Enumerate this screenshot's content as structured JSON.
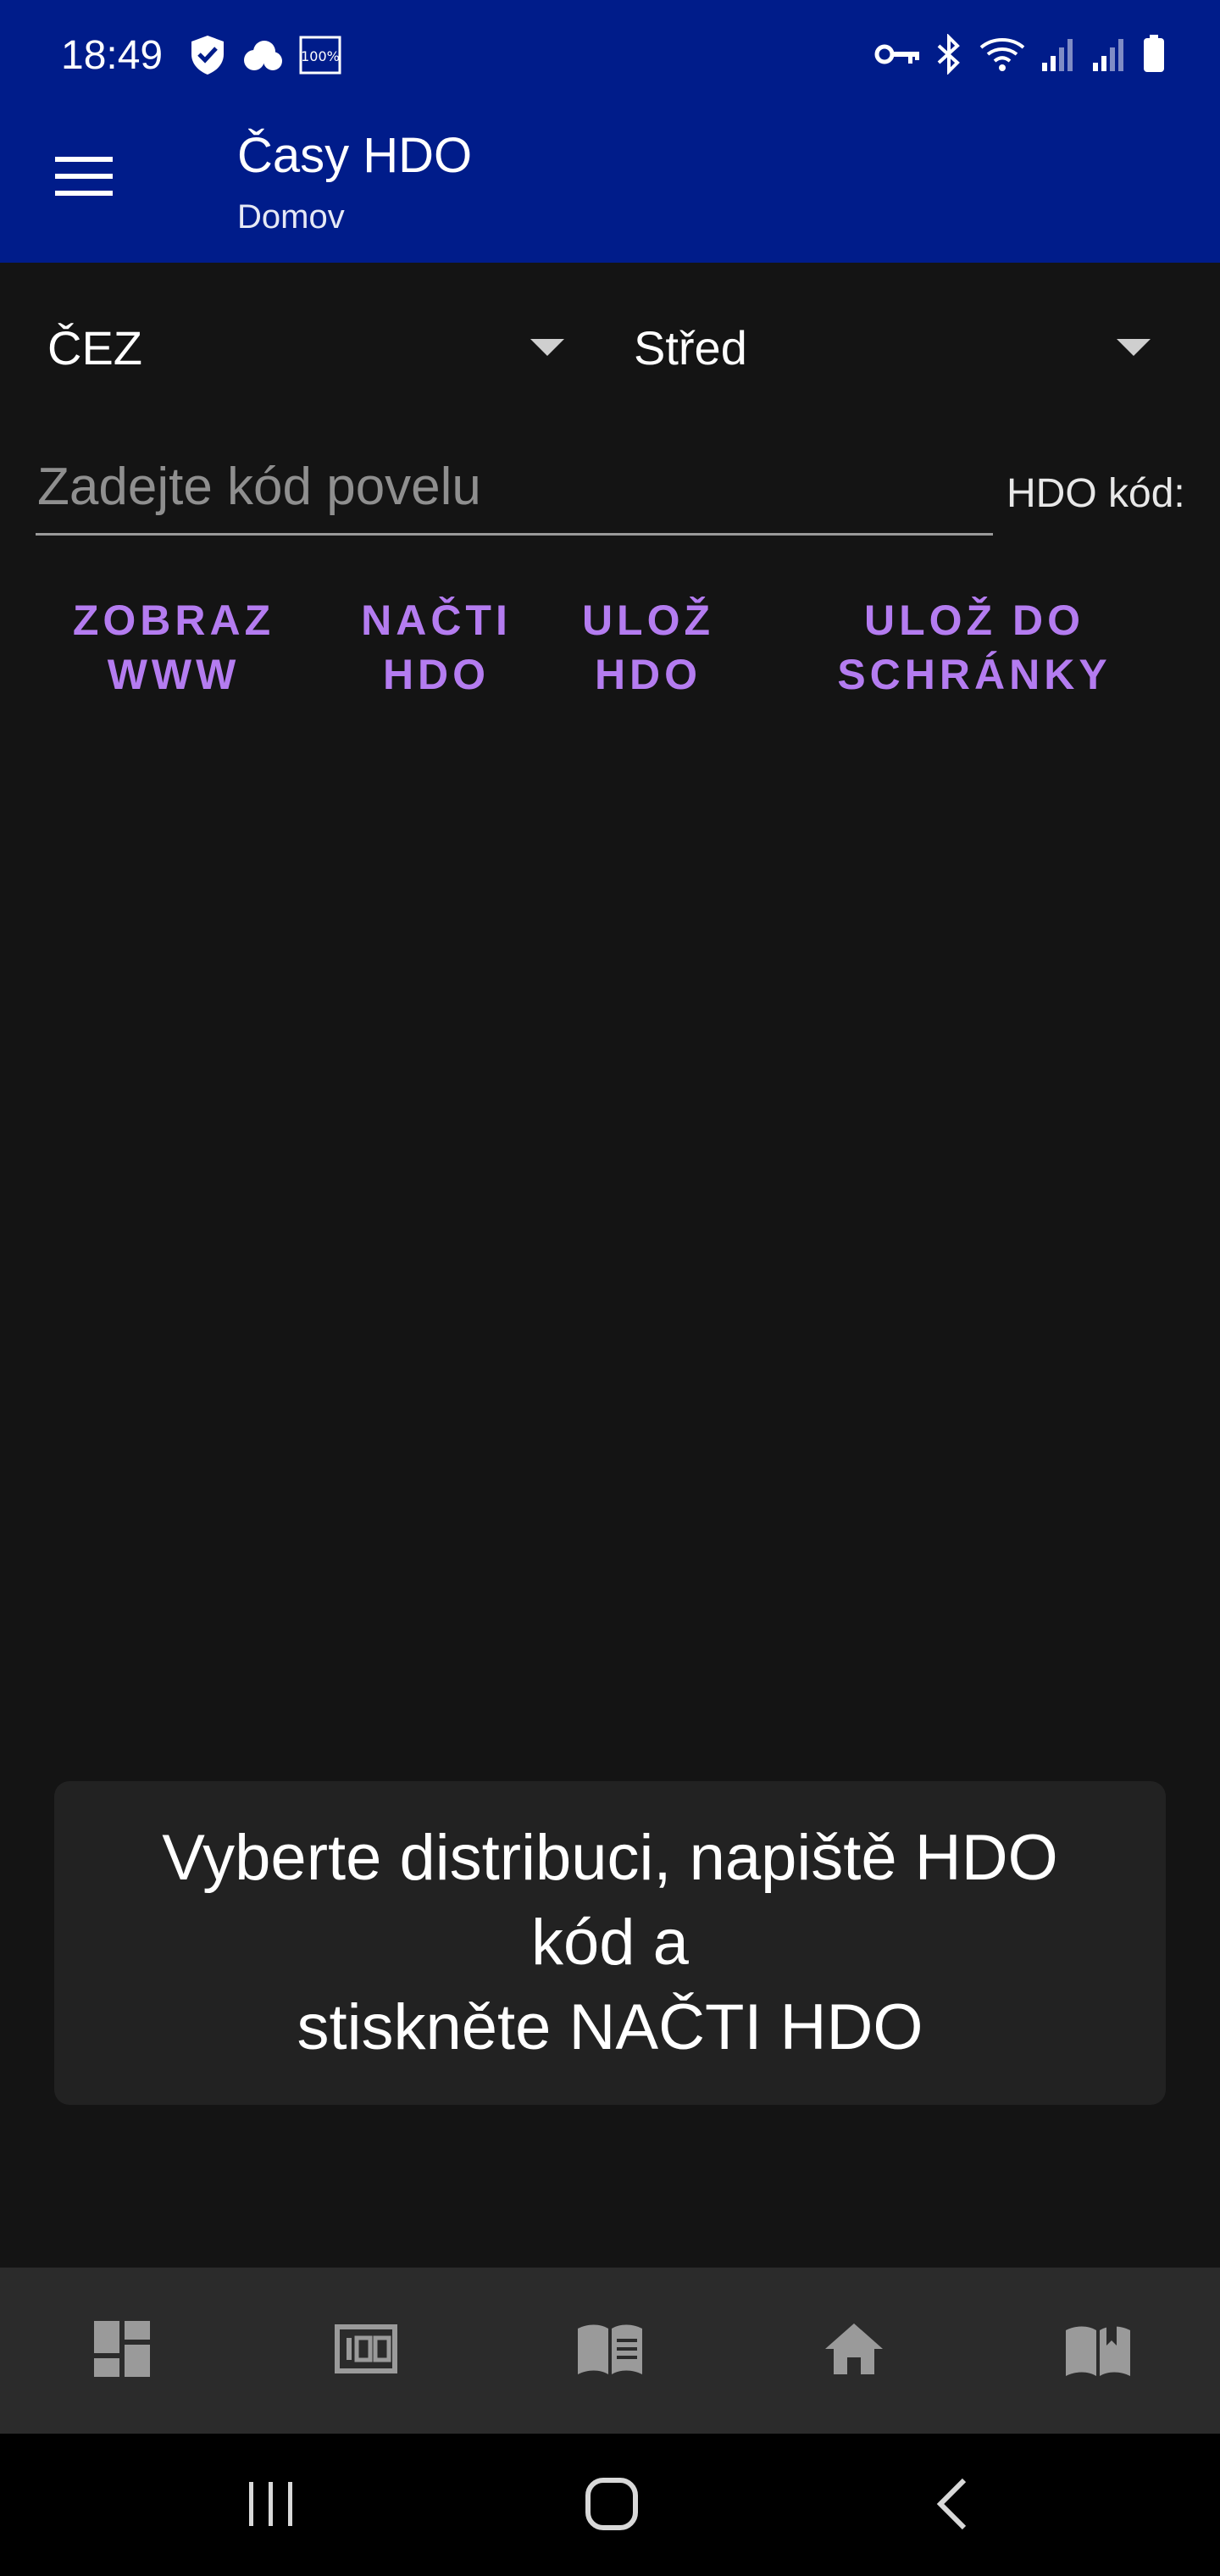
{
  "status_bar": {
    "time": "18:49",
    "battery_saver_text": "100%"
  },
  "app_bar": {
    "title": "Časy HDO",
    "subtitle": "Domov"
  },
  "spinners": {
    "distribution": "ČEZ",
    "region": "Střed"
  },
  "input": {
    "placeholder": "Zadejte kód povelu",
    "value": "",
    "label": "HDO kód:"
  },
  "buttons": {
    "show_www": "ZOBRAZ\nWWW",
    "load_hdo": "NAČTI\nHDO",
    "save_hdo": "ULOŽ\nHDO",
    "save_clipboard": "ULOŽ DO\nSCHRÁNKY"
  },
  "info_card": {
    "message": "Vyberte distribuci, napiště HDO\nkód a\nstiskněte NAČTI HDO"
  },
  "bottom_nav": {
    "items": [
      "dashboard-icon",
      "counter-icon",
      "book-icon",
      "home-icon",
      "map-book-icon"
    ]
  },
  "colors": {
    "app_bar": "#001c8a",
    "background": "#141414",
    "accent": "#b47cf0",
    "card": "#222222",
    "bottom_nav": "#2b2b2b"
  }
}
